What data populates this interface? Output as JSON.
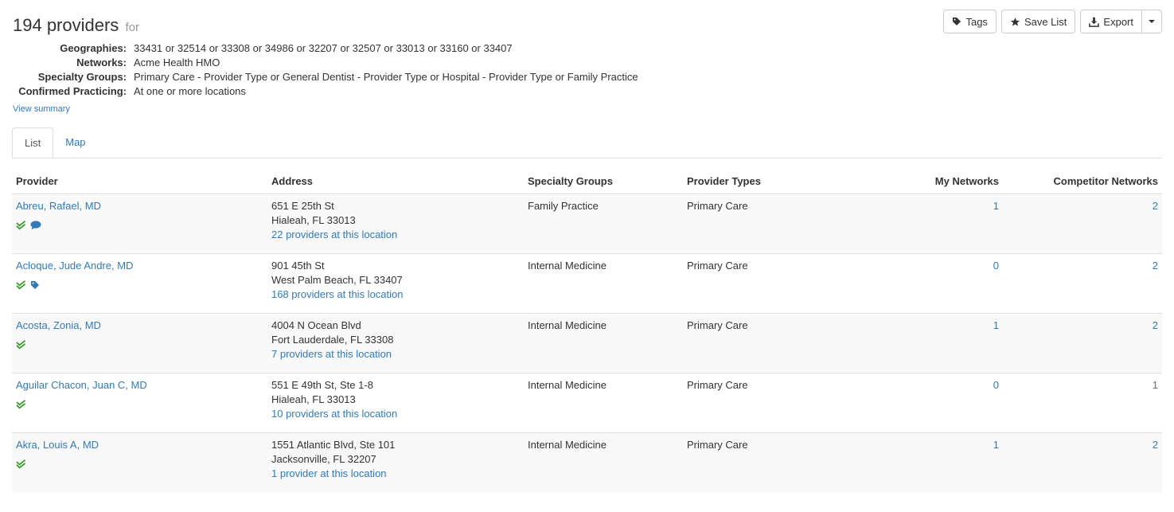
{
  "header": {
    "count_title": "194 providers",
    "for_label": "for"
  },
  "criteria": [
    {
      "label": "Geographies:",
      "value": "33431 or 32514 or 33308 or 34986 or 32207 or 32507 or 33013 or 33160 or 33407"
    },
    {
      "label": "Networks:",
      "value": "Acme Health HMO"
    },
    {
      "label": "Specialty Groups:",
      "value": "Primary Care - Provider Type or General Dentist - Provider Type or Hospital - Provider Type or Family Practice"
    },
    {
      "label": "Confirmed Practicing:",
      "value": "At one or more locations"
    }
  ],
  "view_summary": "View summary",
  "toolbar": {
    "tags_label": "Tags",
    "save_list_label": "Save List",
    "export_label": "Export"
  },
  "tabs": [
    {
      "label": "List",
      "active": true
    },
    {
      "label": "Map",
      "active": false
    }
  ],
  "table": {
    "columns": {
      "provider": "Provider",
      "address": "Address",
      "specialty_groups": "Specialty Groups",
      "provider_types": "Provider Types",
      "my_networks": "My Networks",
      "competitor_networks": "Competitor Networks"
    },
    "rows": [
      {
        "name": "Abreu, Rafael, MD",
        "icons": [
          "double-check-icon",
          "comment-icon"
        ],
        "address1": "651 E 25th St",
        "address2": "Hialeah, FL 33013",
        "location_link": "22 providers at this location",
        "specialty": "Family Practice",
        "provider_type": "Primary Care",
        "my_networks": "1",
        "competitor_networks": "2"
      },
      {
        "name": "Acloque, Jude Andre, MD",
        "icons": [
          "double-check-icon",
          "tag-icon"
        ],
        "address1": "901 45th St",
        "address2": "West Palm Beach, FL 33407",
        "location_link": "168 providers at this location",
        "specialty": "Internal Medicine",
        "provider_type": "Primary Care",
        "my_networks": "0",
        "competitor_networks": "2"
      },
      {
        "name": "Acosta, Zonia, MD",
        "icons": [
          "double-check-icon"
        ],
        "address1": "4004 N Ocean Blvd",
        "address2": "Fort Lauderdale, FL 33308",
        "location_link": "7 providers at this location",
        "specialty": "Internal Medicine",
        "provider_type": "Primary Care",
        "my_networks": "1",
        "competitor_networks": "2"
      },
      {
        "name": "Aguilar Chacon, Juan C, MD",
        "icons": [
          "double-check-icon"
        ],
        "address1": "551 E 49th St, Ste 1-8",
        "address2": "Hialeah, FL 33013",
        "location_link": "10 providers at this location",
        "specialty": "Internal Medicine",
        "provider_type": "Primary Care",
        "my_networks": "0",
        "competitor_networks": "1"
      },
      {
        "name": "Akra, Louis A, MD",
        "icons": [
          "double-check-icon"
        ],
        "address1": "1551 Atlantic Blvd, Ste 101",
        "address2": "Jacksonville, FL 32207",
        "location_link": "1 provider at this location",
        "specialty": "Internal Medicine",
        "provider_type": "Primary Care",
        "my_networks": "1",
        "competitor_networks": "2"
      }
    ]
  },
  "colors": {
    "link": "#337ab7",
    "check_green": "#3c9a2c",
    "border": "#dddddd",
    "stripe": "#f9f9f9"
  }
}
